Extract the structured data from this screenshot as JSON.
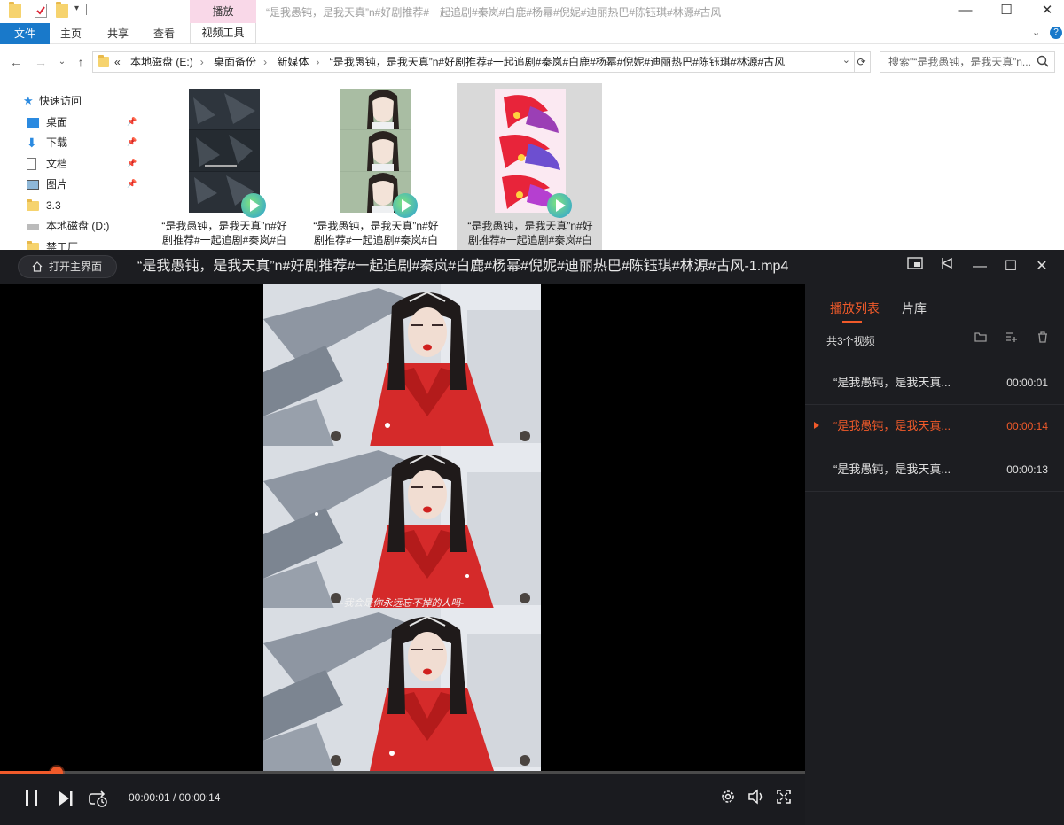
{
  "explorer": {
    "window_title": "“是我愚钝，是我天真”n#好剧推荐#一起追剧#秦岚#白鹿#杨幂#倪妮#迪丽热巴#陈钰琪#林源#古风",
    "context_tab": "播放",
    "ribbon_tabs": {
      "file": "文件",
      "home": "主页",
      "share": "共享",
      "view": "查看",
      "video_tools": "视频工具"
    },
    "address_path": [
      "本地磁盘 (E:)",
      "桌面备份",
      "新媒体",
      "“是我愚钝，是我天真”n#好剧推荐#一起追剧#秦岚#白鹿#杨幂#倪妮#迪丽热巴#陈钰琪#林源#古风"
    ],
    "address_prefix": "«",
    "search_placeholder": "搜索\"“是我愚钝，是我天真”n...",
    "sidebar": {
      "quick_access": "快速访问",
      "items": [
        {
          "label": "桌面",
          "icon": "desktop-icon",
          "pinned": true
        },
        {
          "label": "下载",
          "icon": "download-icon",
          "pinned": true
        },
        {
          "label": "文档",
          "icon": "document-icon",
          "pinned": true
        },
        {
          "label": "图片",
          "icon": "pictures-icon",
          "pinned": true
        },
        {
          "label": "3.3",
          "icon": "folder-icon",
          "pinned": false
        },
        {
          "label": "本地磁盘 (D:)",
          "icon": "drive-icon",
          "pinned": false
        },
        {
          "label": "禁工厂",
          "icon": "folder-icon",
          "pinned": false
        }
      ]
    },
    "files": [
      {
        "label": "“是我愚钝，是我天真”n#好剧推荐#一起追剧#秦岚#白",
        "selected": false
      },
      {
        "label": "“是我愚钝，是我天真”n#好剧推荐#一起追剧#秦岚#白",
        "selected": false
      },
      {
        "label": "“是我愚钝，是我天真”n#好剧推荐#一起追剧#秦岚#白",
        "selected": true
      }
    ]
  },
  "player": {
    "home_button": "打开主界面",
    "title": "“是我愚钝，是我天真”n#好剧推荐#一起追剧#秦岚#白鹿#杨幂#倪妮#迪丽热巴#陈钰琪#林源#古风-1.mp4",
    "subtitle": "-我会是你永远忘不掉的人吗-",
    "time_display": "00:00:01 / 00:00:14",
    "progress_fraction": 0.07,
    "accent_color": "#f05a2a",
    "playlist": {
      "tab_playlist": "播放列表",
      "tab_library": "片库",
      "count": "共3个视频",
      "items": [
        {
          "name": "“是我愚钝，是我天真...",
          "duration": "00:00:01",
          "current": false
        },
        {
          "name": "“是我愚钝，是我天真...",
          "duration": "00:00:14",
          "current": true
        },
        {
          "name": "“是我愚钝，是我天真...",
          "duration": "00:00:13",
          "current": false
        }
      ]
    }
  }
}
